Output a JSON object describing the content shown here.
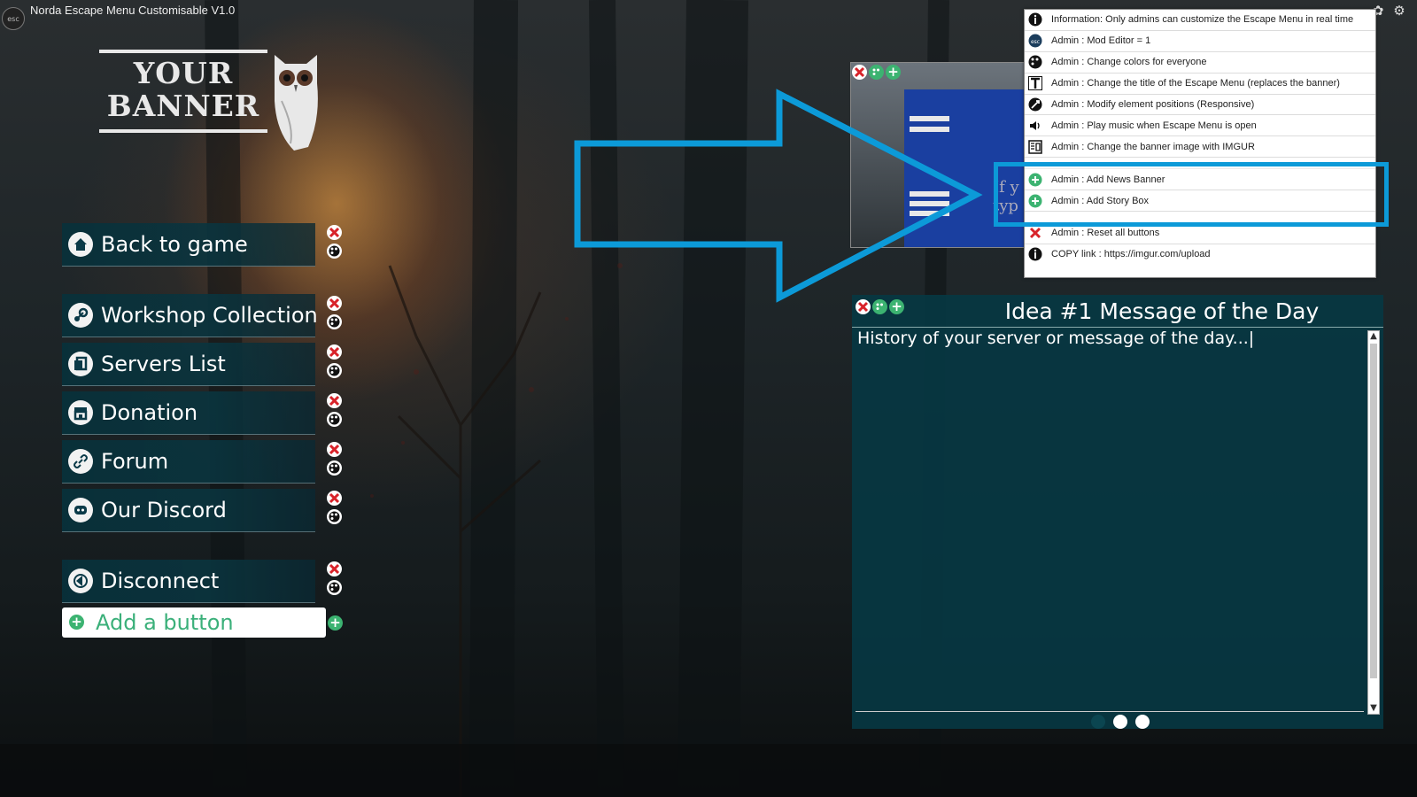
{
  "app": {
    "title": "Norda Escape Menu Customisable V1.0",
    "esc_label": "esc"
  },
  "banner": {
    "line1": "YOUR",
    "line2": "BANNER"
  },
  "menu": [
    {
      "label": "Back to game",
      "icon": "home-icon"
    },
    {
      "label": "Workshop Collection",
      "icon": "steam-icon"
    },
    {
      "label": "Servers List",
      "icon": "servers-icon"
    },
    {
      "label": "Donation",
      "icon": "store-icon"
    },
    {
      "label": "Forum",
      "icon": "link-icon"
    },
    {
      "label": "Our Discord",
      "icon": "discord-icon"
    },
    {
      "label": "Disconnect",
      "icon": "disconnect-icon"
    }
  ],
  "add_button": {
    "label": "Add a button"
  },
  "admin_menu": {
    "items": [
      {
        "label": "Information: Only admins can customize the Escape Menu in real time",
        "icon": "info-icon"
      },
      {
        "label": "Admin : Mod Editor = 1",
        "icon": "esc-icon"
      },
      {
        "label": "Admin : Change colors for everyone",
        "icon": "palette-icon"
      },
      {
        "label": "Admin : Change the title of the Escape Menu (replaces the banner)",
        "icon": "text-icon"
      },
      {
        "label": "Admin : Modify element positions (Responsive)",
        "icon": "move-icon"
      },
      {
        "label": "Admin : Play music when Escape Menu is open",
        "icon": "speaker-icon"
      },
      {
        "label": "Admin : Change the banner image with IMGUR",
        "icon": "image-icon"
      },
      {
        "label": "Admin : Add News Banner",
        "icon": "add-icon"
      },
      {
        "label": "Admin : Add Story Box",
        "icon": "add-icon"
      },
      {
        "label": "Admin : Reset all buttons",
        "icon": "reset-icon"
      },
      {
        "label": "COPY link : https://imgur.com/upload",
        "icon": "info-icon"
      }
    ]
  },
  "motd": {
    "title": "Idea #1 Message of the Day",
    "text": "History of your server or message of the day...|"
  },
  "preview": {
    "snippet": "If y typ"
  },
  "colors": {
    "accent": "#0c9ad8",
    "panel": "#06374a",
    "green": "#3cb371",
    "red": "#d8232a"
  }
}
